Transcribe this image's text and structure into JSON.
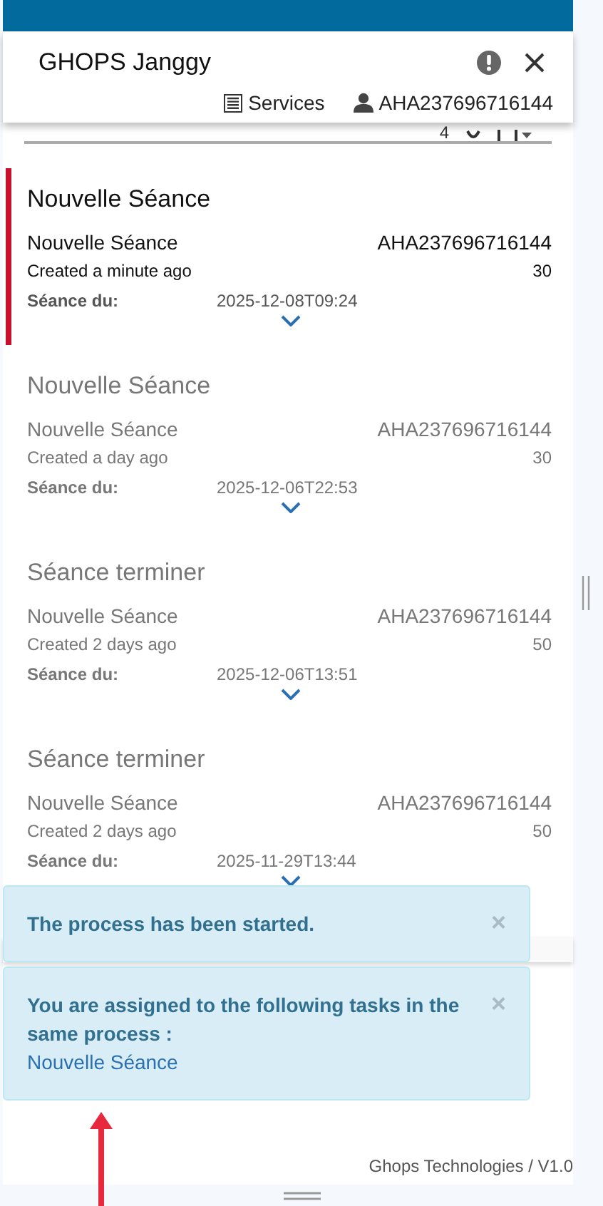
{
  "header": {
    "title": "GHOPS Janggy",
    "services": "Services",
    "user": "AHA237696716144"
  },
  "toolbar": {
    "count": "4"
  },
  "tasks": [
    {
      "title": "Nouvelle Séance",
      "name": "Nouvelle Séance",
      "assignee": "AHA237696716144",
      "created": "Created a minute ago",
      "score": "30",
      "date_label": "Séance du:",
      "date": "2025-12-08T09:24",
      "selected": true
    },
    {
      "title": "Nouvelle Séance",
      "name": "Nouvelle Séance",
      "assignee": "AHA237696716144",
      "created": "Created a day ago",
      "score": "30",
      "date_label": "Séance du:",
      "date": "2025-12-06T22:53",
      "selected": false
    },
    {
      "title": "Séance terminer",
      "name": "Nouvelle Séance",
      "assignee": "AHA237696716144",
      "created": "Created 2 days ago",
      "score": "50",
      "date_label": "Séance du:",
      "date": "2025-12-06T13:51",
      "selected": false
    },
    {
      "title": "Séance terminer",
      "name": "Nouvelle Séance",
      "assignee": "AHA237696716144",
      "created": "Created 2 days ago",
      "score": "50",
      "date_label": "Séance du:",
      "date": "2025-11-29T13:44",
      "selected": false
    }
  ],
  "notifications": [
    {
      "message": "The process has been started.",
      "close": "×"
    },
    {
      "message": "You are assigned to the following tasks in the same process :",
      "link": "Nouvelle Séance",
      "close": "×"
    }
  ],
  "footer": "Ghops Technologies / V1.0"
}
